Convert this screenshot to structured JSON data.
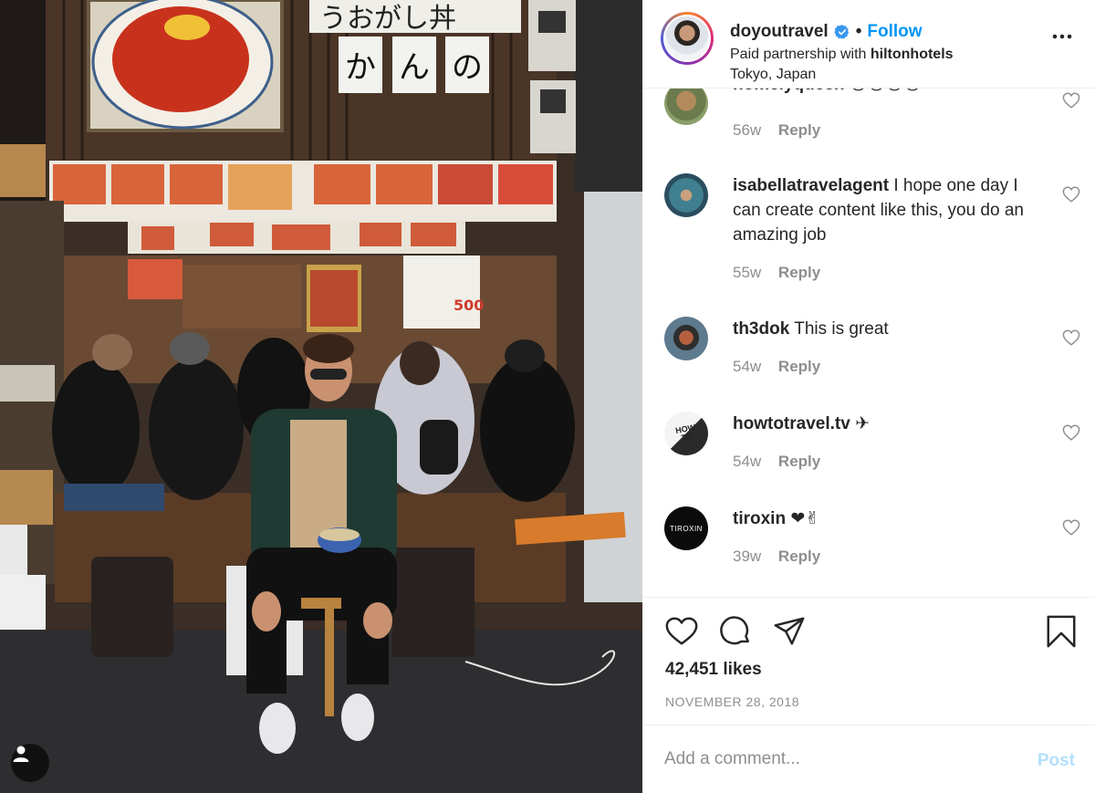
{
  "post": {
    "username": "doyoutravel",
    "verified": true,
    "follow_label": "Follow",
    "separator": "•",
    "partnership_prefix": "Paid partnership with",
    "partner": "hiltonhotels",
    "location": "Tokyo, Japan",
    "more_icon": "more-horizontal-icon"
  },
  "comments": [
    {
      "username": "homelyqueen",
      "text": "😍😍😍😍",
      "age": "56w",
      "reply_label": "Reply"
    },
    {
      "username": "isabellatravelagent",
      "text": "I hope one day I can create content like this, you do an amazing job",
      "age": "55w",
      "reply_label": "Reply"
    },
    {
      "username": "th3dok",
      "text": "This is great",
      "age": "54w",
      "reply_label": "Reply"
    },
    {
      "username": "howtotravel.tv",
      "text": "✈",
      "age": "54w",
      "reply_label": "Reply"
    },
    {
      "username": "tiroxin",
      "text": "❤✌",
      "age": "39w",
      "reply_label": "Reply"
    }
  ],
  "avatar_texts": {
    "howtotravel": "HOW TO",
    "tiroxin": "TIROXIN"
  },
  "photo_signs": {
    "top_banner": "うおがし丼",
    "kanji_1": "か",
    "kanji_2": "ん",
    "kanji_3": "の",
    "price": "500"
  },
  "actions": {
    "likes": "42,451 likes",
    "date": "NOVEMBER 28, 2018",
    "icons": [
      "heart-icon",
      "comment-icon",
      "share-icon",
      "bookmark-icon"
    ]
  },
  "composer": {
    "placeholder": "Add a comment...",
    "post_label": "Post"
  },
  "colors": {
    "link_blue": "#0095f6",
    "post_disabled": "#b2dffc",
    "muted": "#8e8e8e",
    "text": "#262626"
  }
}
